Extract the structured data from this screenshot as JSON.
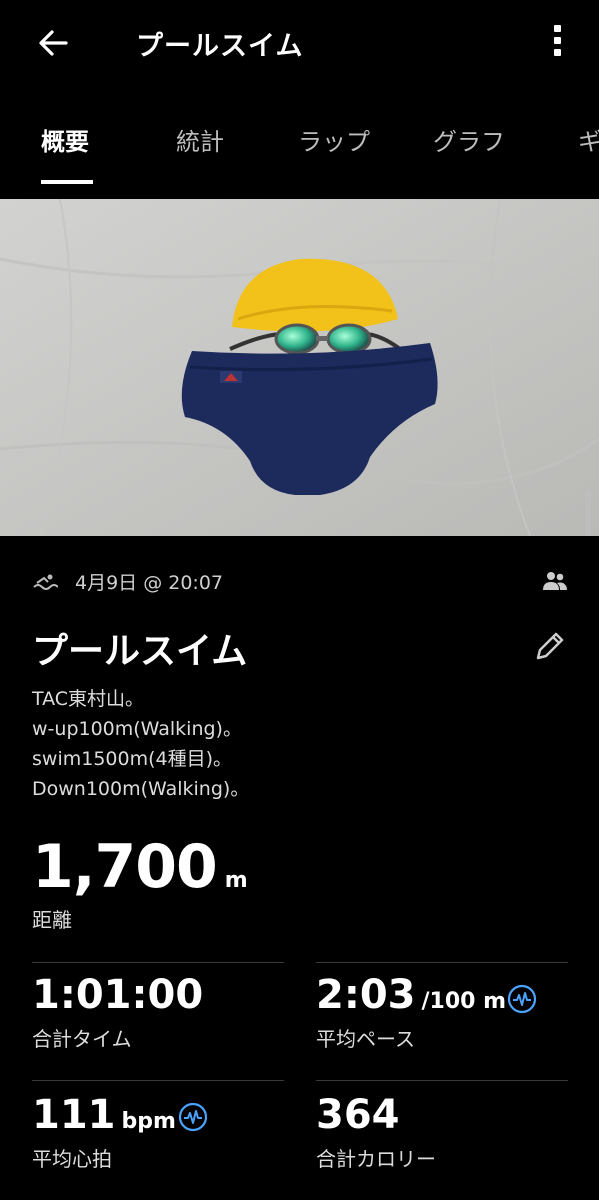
{
  "header": {
    "title": "プールスイム"
  },
  "tabs": [
    {
      "label": "概要",
      "active": true
    },
    {
      "label": "統計",
      "active": false
    },
    {
      "label": "ラップ",
      "active": false
    },
    {
      "label": "グラフ",
      "active": false
    },
    {
      "label": "ギ",
      "active": false
    }
  ],
  "activity": {
    "date": "4月9日 @ 20:07",
    "title": "プールスイム",
    "notes": [
      "TAC東村山。",
      "w-up100m(Walking)。",
      "swim1500m(4種目)。",
      "Down100m(Walking)。"
    ]
  },
  "distance": {
    "value": "1,700",
    "unit": "m",
    "label": "距離"
  },
  "stats": {
    "total_time": {
      "value": "1:01:00",
      "label": "合計タイム"
    },
    "avg_pace": {
      "value": "2:03",
      "unit": "/100 m",
      "label": "平均ペース"
    },
    "avg_hr": {
      "value": "111",
      "unit": "bpm",
      "label": "平均心拍"
    },
    "calories": {
      "value": "364",
      "label": "合計カロリー"
    }
  },
  "colors": {
    "background": "#000000",
    "accent_icon": "#4aa3ff",
    "divider": "#3a3a3a"
  },
  "icons": {
    "back": "arrow-left-icon",
    "more": "more-vertical-icon",
    "activity_type": "swim-icon",
    "privacy": "people-icon",
    "edit": "pencil-icon",
    "insight": "heartbeat-icon"
  }
}
